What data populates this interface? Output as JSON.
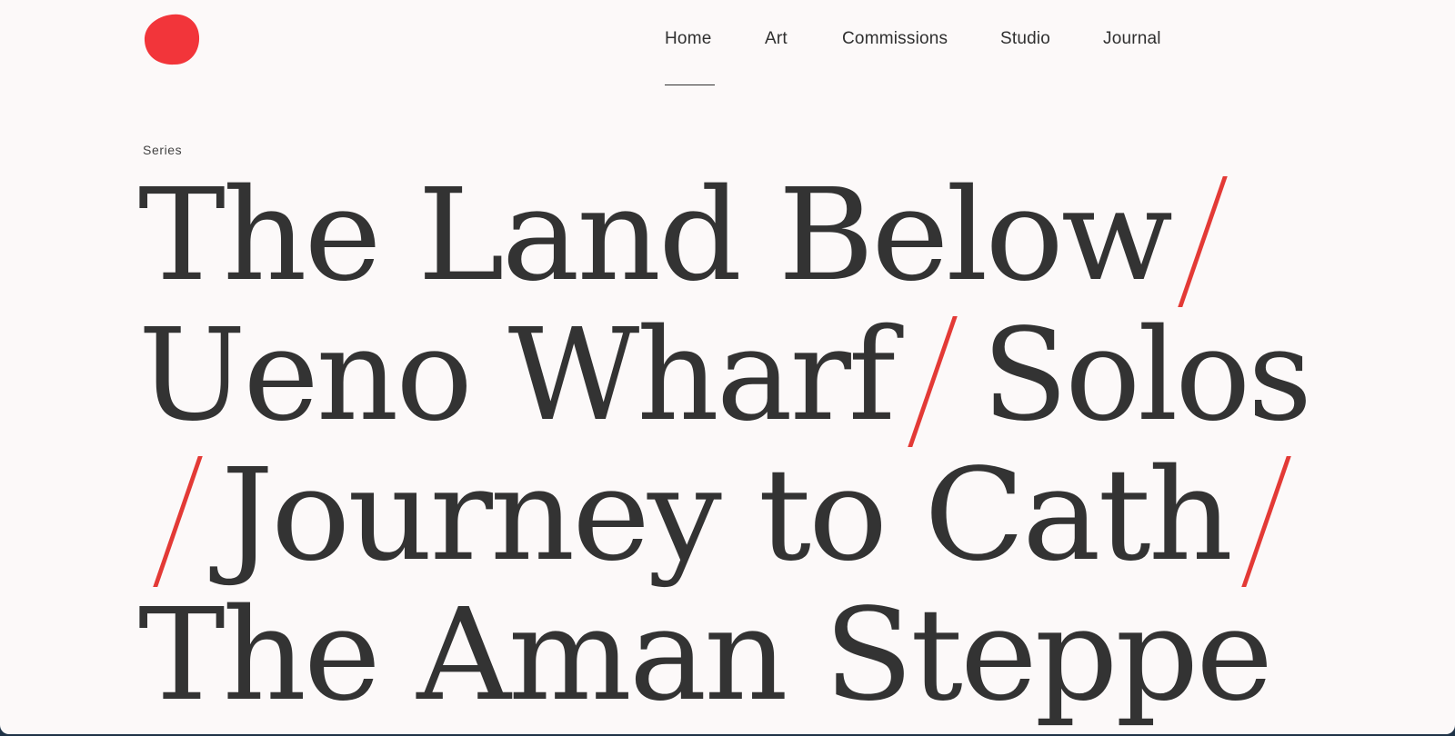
{
  "brand": {
    "logo_color": "#f2353a"
  },
  "nav": {
    "items": [
      "Home",
      "Art",
      "Commissions",
      "Studio",
      "Journal"
    ],
    "active": "Home"
  },
  "kicker": "Series",
  "series": [
    "The Land Below",
    "Ueno Wharf",
    "Solos",
    "Journey to Cath",
    "The Aman Steppe"
  ],
  "colors": {
    "text": "#333333",
    "separator": "#e33a36",
    "background": "#fcf9f9"
  }
}
